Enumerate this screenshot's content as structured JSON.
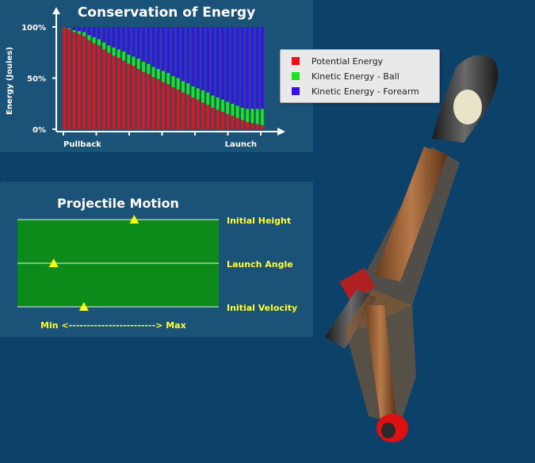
{
  "colors": {
    "background": "#0c4169",
    "panel": "#1b5277",
    "potential": "#ee1111",
    "kinetic_ball": "#19e619",
    "kinetic_forearm": "#3a10ee",
    "track": "#0c8a1a",
    "marker": "#ffff00",
    "label": "#ffff33"
  },
  "energy_panel": {
    "title": "Conservation of Energy"
  },
  "legend": {
    "items": [
      {
        "label": "Potential Energy",
        "color": "#ee1111"
      },
      {
        "label": "Kinetic Energy - Ball",
        "color": "#19e619"
      },
      {
        "label": "Kinetic Energy - Forearm",
        "color": "#3a10ee"
      }
    ]
  },
  "chart_data": {
    "type": "bar",
    "stacked": true,
    "title": "Conservation of Energy",
    "xlabel": "",
    "ylabel": "Energy (Joules)",
    "yticks": [
      "0%",
      "50%",
      "100%"
    ],
    "ylim": [
      0,
      100
    ],
    "x_tick_labels": {
      "start": "Pullback",
      "end": "Launch"
    },
    "categories": [
      1,
      2,
      3,
      4,
      5,
      6,
      7,
      8,
      9,
      10,
      11,
      12,
      13,
      14,
      15,
      16,
      17,
      18,
      19,
      20,
      21,
      22,
      23,
      24,
      25,
      26,
      27,
      28,
      29,
      30,
      31,
      32,
      33,
      34,
      35,
      36,
      37,
      38,
      39,
      40,
      41
    ],
    "series": [
      {
        "name": "Potential Energy",
        "values": [
          100,
          98,
          95,
          93,
          91,
          87,
          84,
          82,
          78,
          75,
          72,
          70,
          67,
          64,
          62,
          59,
          56,
          54,
          51,
          49,
          46,
          44,
          41,
          39,
          36,
          34,
          31,
          29,
          26,
          24,
          21,
          19,
          17,
          15,
          13,
          11,
          9,
          7,
          6,
          5,
          4
        ]
      },
      {
        "name": "Kinetic Energy - Ball",
        "values": [
          0,
          1,
          2,
          3,
          4,
          5,
          6,
          6,
          7,
          7,
          8,
          8,
          9,
          9,
          9,
          10,
          10,
          10,
          10,
          10,
          11,
          11,
          11,
          11,
          11,
          11,
          11,
          11,
          12,
          12,
          12,
          12,
          12,
          12,
          12,
          12,
          12,
          13,
          14,
          15,
          16
        ]
      },
      {
        "name": "Kinetic Energy - Forearm",
        "values": [
          0,
          1,
          3,
          4,
          5,
          8,
          10,
          12,
          15,
          18,
          20,
          22,
          24,
          27,
          29,
          31,
          34,
          36,
          39,
          41,
          43,
          45,
          48,
          50,
          53,
          55,
          58,
          60,
          62,
          64,
          67,
          69,
          71,
          73,
          75,
          77,
          79,
          80,
          80,
          80,
          80
        ]
      }
    ]
  },
  "projectile_panel": {
    "title": "Projectile Motion",
    "sliders": [
      {
        "label": "Initial Height",
        "level": 0.58
      },
      {
        "label": "Launch Angle",
        "level": 0.18
      },
      {
        "label": "Initial Velocity",
        "level": 0.33
      }
    ],
    "range_label": "Min <------------------------> Max"
  }
}
